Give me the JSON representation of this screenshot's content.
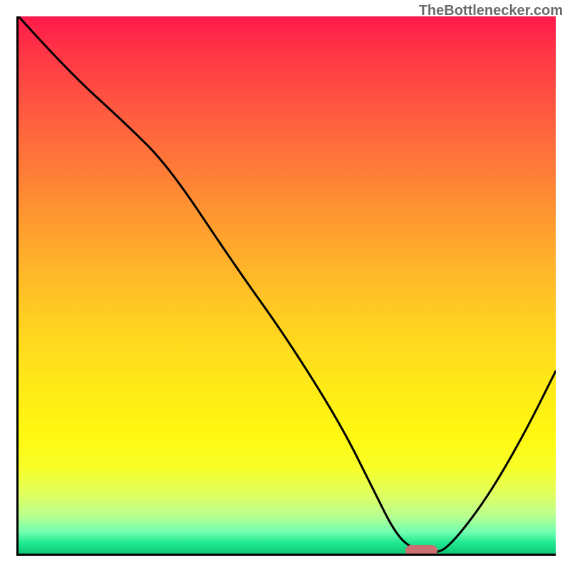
{
  "watermark_text": "TheBottlenecker.com",
  "chart_data": {
    "type": "line",
    "title": "",
    "xlabel": "",
    "ylabel": "",
    "xlim": [
      0,
      100
    ],
    "ylim": [
      0,
      100
    ],
    "background": "vertical red-to-green spectrum gradient",
    "series": [
      {
        "name": "bottleneck-curve",
        "x": [
          0,
          9,
          20,
          28,
          40,
          50,
          60,
          66,
          70,
          73,
          77,
          80,
          87,
          94,
          100
        ],
        "values": [
          100,
          90,
          80,
          72,
          54,
          40,
          24,
          12,
          4,
          1,
          0,
          1,
          10,
          22,
          34
        ]
      }
    ],
    "marker": {
      "name": "optimal-range-marker",
      "x_start": 72,
      "x_end": 78,
      "y": 0.5,
      "color": "#cc6f70"
    }
  }
}
